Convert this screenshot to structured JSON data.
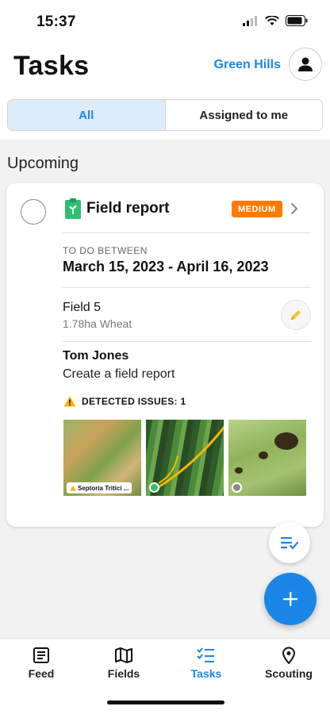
{
  "status_bar": {
    "time": "15:37"
  },
  "header": {
    "title": "Tasks",
    "farm_name": "Green Hills"
  },
  "segments": {
    "all": "All",
    "assigned": "Assigned to me",
    "active": "all"
  },
  "section": {
    "title": "Upcoming"
  },
  "task": {
    "title": "Field report",
    "priority": "MEDIUM",
    "todo_label": "TO DO BETWEEN",
    "dates": "March 15, 2023 - April 16, 2023",
    "field_name": "Field 5",
    "field_detail": "1.78ha Wheat",
    "assignee": "Tom Jones",
    "description": "Create a field report",
    "issues_label": "DETECTED ISSUES: 1",
    "photos": [
      {
        "tag": "Septoria Tritici ..."
      },
      {
        "status_color": "#2fbf71"
      },
      {
        "status_color": "#8a8a8a"
      }
    ]
  },
  "colors": {
    "accent": "#1a86e8",
    "priority": "#ff7a00",
    "report_icon": "#2fbf71"
  },
  "tabs": [
    {
      "label": "Feed",
      "icon": "feed-icon"
    },
    {
      "label": "Fields",
      "icon": "map-icon"
    },
    {
      "label": "Tasks",
      "icon": "tasks-icon",
      "active": true
    },
    {
      "label": "Scouting",
      "icon": "location-pin-icon"
    }
  ]
}
